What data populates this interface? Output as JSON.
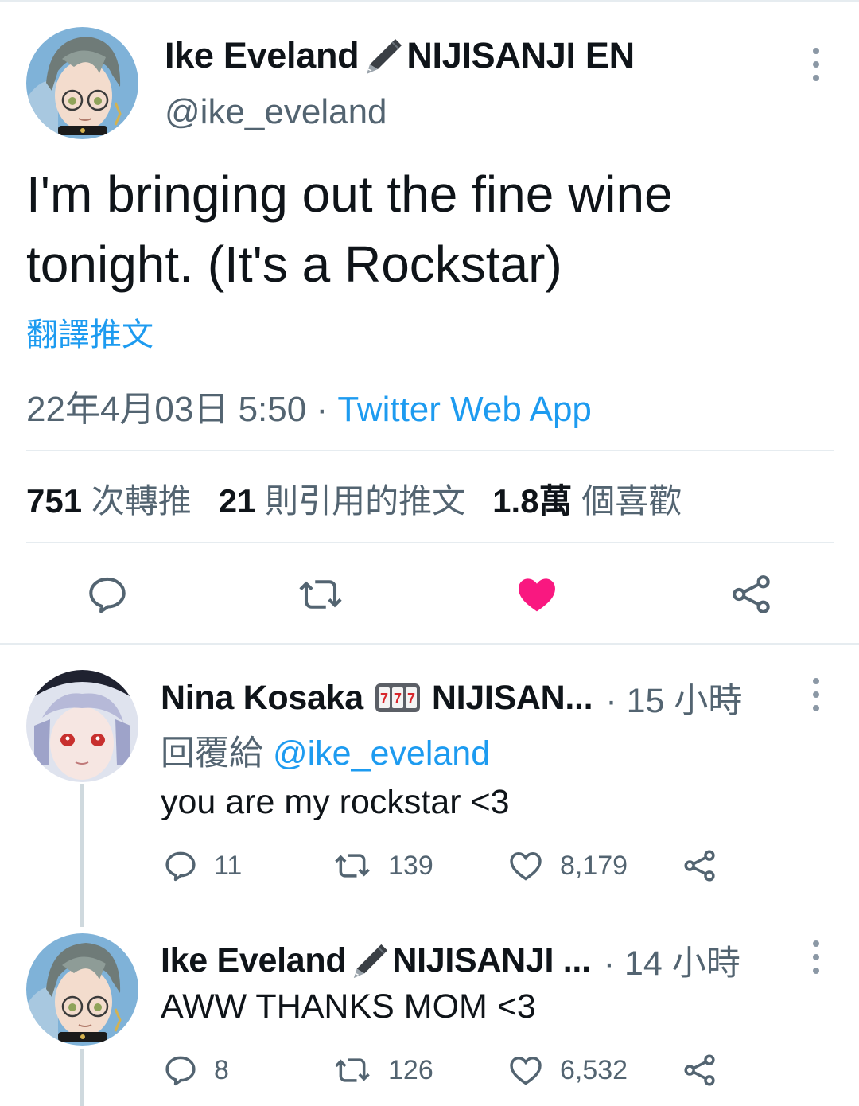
{
  "main_tweet": {
    "display_name": "Ike Eveland",
    "name_suffix": "NIJISANJI EN",
    "handle": "@ike_eveland",
    "text": "I'm bringing out the fine wine tonight. (It's a Rockstar)",
    "translate_label": "翻譯推文",
    "timestamp": "22年4月03日 5:50",
    "separator": "·",
    "source": "Twitter Web App",
    "stats": {
      "retweets_count": "751",
      "retweets_label": "次轉推",
      "quotes_count": "21",
      "quotes_label": "則引用的推文",
      "likes_count": "1.8萬",
      "likes_label": "個喜歡"
    },
    "liked": true
  },
  "replies": [
    {
      "display_name": "Nina Kosaka",
      "name_suffix": "NIJISAN...",
      "time": "· 15 小時",
      "reply_to_label": "回覆給",
      "reply_to_handle": "@ike_eveland",
      "text": "you are my rockstar <3",
      "reply_count": "11",
      "retweet_count": "139",
      "like_count": "8,179"
    },
    {
      "display_name": "Ike Eveland",
      "name_suffix": "NIJISANJI ...",
      "time": "· 14 小時",
      "text": "AWW THANKS MOM <3",
      "reply_count": "8",
      "retweet_count": "126",
      "like_count": "6,532"
    }
  ],
  "icons": {
    "pen": "fountain-pen-icon",
    "slot": "slot-machine-icon",
    "reply": "reply-icon",
    "retweet": "retweet-icon",
    "like": "heart-icon",
    "share": "share-icon",
    "more": "more-icon"
  },
  "colors": {
    "accent": "#1d9bf0",
    "like": "#f91880",
    "secondary_text": "#536471",
    "divider": "#e6ecf0"
  }
}
